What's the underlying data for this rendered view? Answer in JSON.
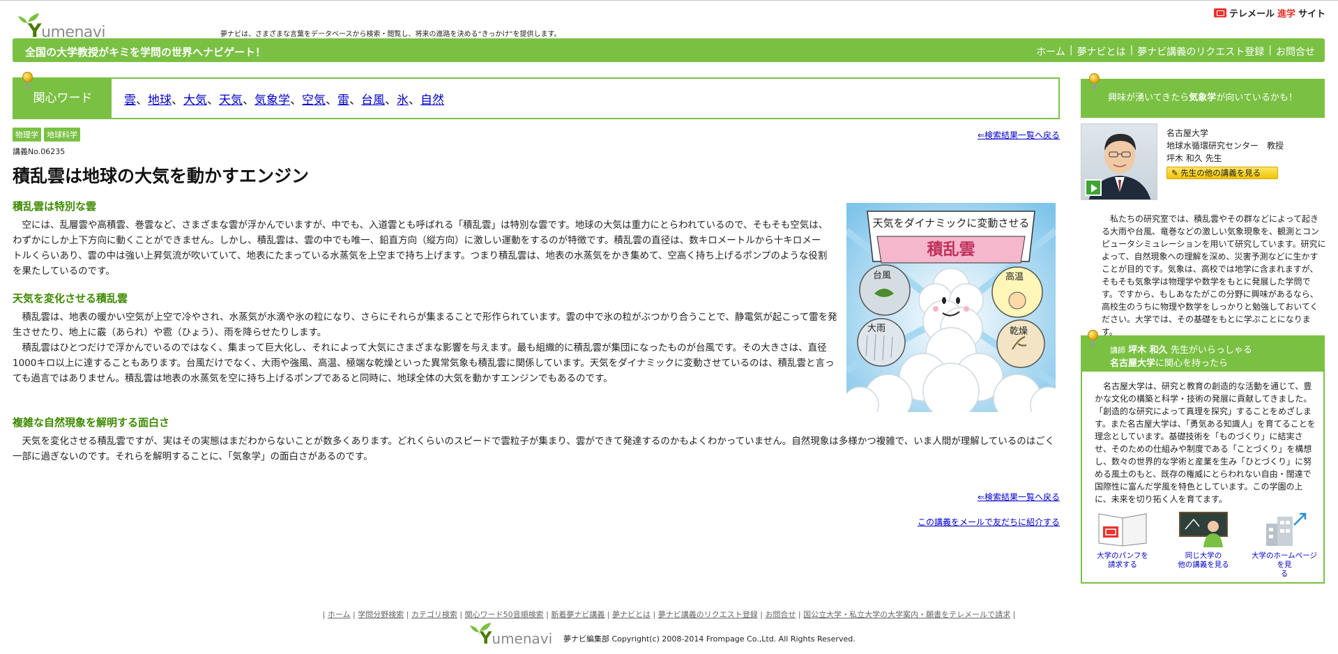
{
  "header": {
    "logo_letter": "Y",
    "logo_rest": "umenavi",
    "tagline": "夢ナビは、さまざまな言葉をデータベースから検索・閲覧し、将来の進路を決める“きっかけ”を提供します。",
    "telemail_pre": "テレメール",
    "telemail_accent": "進学",
    "telemail_post": "サイト",
    "slogan": "全国の大学教授がキミを学問の世界へナビゲート！",
    "nav": [
      "ホーム",
      "夢ナビとは",
      "夢ナビ講義のリクエスト登録",
      "お問合せ"
    ]
  },
  "keywords": {
    "label": "関心ワード",
    "items": [
      "雲",
      "地球",
      "大気",
      "天気",
      "気象学",
      "空気",
      "雷",
      "台風",
      "氷",
      "自然"
    ]
  },
  "tags": [
    "物理学",
    "地球科学"
  ],
  "back_link": "⇐検索結果一覧へ戻る",
  "lecture_no": "講義No.06235",
  "title": "積乱雲は地球の大気を動かすエンジン",
  "sections": [
    {
      "heading": "積乱雲は特別な雲",
      "paragraphs": [
        "空には、乱層雲や高積雲、巻雲など、さまざまな雲が浮かんでいますが、中でも、入道雲とも呼ばれる「積乱雲」は特別な雲です。地球の大気は重力にとらわれているので、そもそも空気は、わずかにしか上下方向に動くことができません。しかし、積乱雲は、雲の中でも唯一、鉛直方向（縦方向）に激しい運動をするのが特徴です。積乱雲の直径は、数キロメートルから十キロメートルくらいあり、雲の中は強い上昇気流が吹いていて、地表にたまっている水蒸気を上空まで持ち上げます。つまり積乱雲は、地表の水蒸気をかき集めて、空高く持ち上げるポンプのような役割を果たしているのです。"
      ]
    },
    {
      "heading": "天気を変化させる積乱雲",
      "paragraphs": [
        "積乱雲は、地表の暖かい空気が上空で冷やされ、水蒸気が水滴や氷の粒になり、さらにそれらが集まることで形作られています。雲の中で氷の粒がぶつかり合うことで、静電気が起こって雷を発生させたり、地上に霰（あられ）や雹（ひょう）、雨を降らせたりします。",
        "積乱雲はひとつだけで浮かんでいるのではなく、集まって巨大化し、それによって大気にさまざまな影響を与えます。最も組織的に積乱雲が集団になったものが台風です。その大きさは、直径1000キロ以上に達することもあります。台風だけでなく、大雨や強風、高温、極端な乾燥といった異常気象も積乱雲に関係しています。天気をダイナミックに変動させているのは、積乱雲と言っても過言ではありません。積乱雲は地表の水蒸気を空に持ち上げるポンプであると同時に、地球全体の大気を動かすエンジンでもあるのです。"
      ]
    },
    {
      "heading": "複雑な自然現象を解明する面白さ",
      "paragraphs": [
        "天気を変化させる積乱雲ですが、実はその実態はまだわからないことが数多くあります。どれくらいのスピードで雲粒子が集まり、雲ができて発達するのかもよくわかっていません。自然現象は多様かつ複雑で、いま人間が理解しているのはごく一部に過ぎないのです。それらを解明することに、「気象学」の面白さがあるのです。"
      ]
    }
  ],
  "illustration": {
    "banner_line1": "天気をダイナミックに変動させる",
    "banner_line2": "積乱雲",
    "labels": [
      "台風",
      "高温",
      "大雨",
      "乾燥"
    ]
  },
  "mail_friend": "この講義をメールで友だちに紹介する",
  "right": {
    "head_pre": "興味が湧いてきたら",
    "head_accent": "気象学",
    "head_post": "が向いているかも！",
    "teacher": {
      "university": "名古屋大学",
      "dept": "地球水循環研究センター　教授",
      "name": "坪木 和久 先生"
    },
    "other_button": "先生の他の講義を見る",
    "lab_text": "私たちの研究室では、積乱雲やその群などによって起きる大雨や台風、竜巻などの激しい気象現象を、観測とコンピュータシミュレーションを用いて研究しています。研究によって、自然現象への理解を深め、災害予測などに生かすことが目的です。気象は、高校では地学に含まれますが、そもそも気象学は物理学や数学をもとに発展した学問です。ですから、もしあなたがこの分野に興味があるなら、高校生のうちに物理や数学をしっかりと勉強しておいてください。大学では、その基礎をもとに学ぶことになります。",
    "univ_head_l1_pre": "講師",
    "univ_head_l1_name": "坪木 和久",
    "univ_head_l1_post": "先生がいらっしゃる",
    "univ_head_l2_name": "名古屋大学",
    "univ_head_l2_post": "に関心を持ったら",
    "univ_text": "名古屋大学は、研究と教育の創造的な活動を通じて、豊かな文化の構築と科学・技術の発展に貢献してきました。「創造的な研究によって真理を探究」することをめざします。また名古屋大学は、「勇気ある知識人」を育てることを理念としています。基礎技術を「ものづくり」に結実させ、そのための仕組みや制度である「ことづくり」を構想し、数々の世界的な学術と産業を生み「ひとづくり」に努める風土のもと、既存の権威にとらわれない自由・闊達で国際性に富んだ学風を特色としています。この学園の上に、未来を切り拓く人を育てます。",
    "icons": [
      {
        "line1": "大学のパンフを",
        "line2": "請求する"
      },
      {
        "line1": "同じ大学の",
        "line2": "他の講義を見る"
      },
      {
        "line1": "大学のホームページを見",
        "line2": "る"
      }
    ]
  },
  "footer": {
    "links": [
      "ホーム",
      "学問分野検索",
      "カテゴリ検索",
      "関心ワード50音順検索",
      "新着夢ナビ講義",
      "夢ナビとは",
      "夢ナビ講義のリクエスト登録",
      "お問合せ",
      "国公立大学・私立大学の大学案内・願書をテレメールで請求"
    ],
    "editor": "夢ナビ編集部",
    "copyright": "Copyright(c) 2008-2014 Frompage Co.,Ltd. All Rights Reserved."
  },
  "colors": {
    "brand_green": "#7ac143",
    "heading_green": "#3d8a00",
    "link_blue": "#0000cc",
    "telemail_red": "#e8322b"
  }
}
